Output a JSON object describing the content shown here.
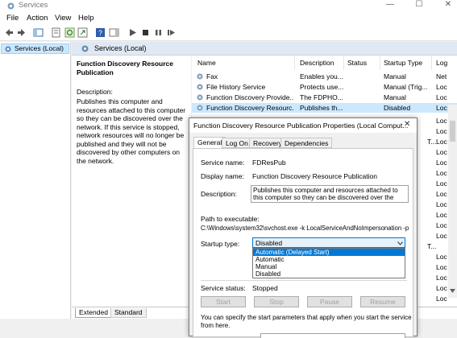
{
  "window": {
    "title": "Services",
    "minimize": "—",
    "maximize": "☐",
    "close": "✕"
  },
  "menu": [
    "File",
    "Action",
    "View",
    "Help"
  ],
  "tree": {
    "selected_label": "Services (Local)"
  },
  "header": {
    "label": "Services (Local)"
  },
  "description_panel": {
    "service_title": "Function Discovery Resource Publication",
    "desc_heading": "Description:",
    "desc_lines": [
      "Publishes this computer and",
      "resources attached to this computer",
      "so they can be discovered over the",
      "network.  If this service is stopped,",
      "network resources will no longer be",
      "published and they will not be",
      "discovered by other computers on",
      "the network."
    ]
  },
  "list": {
    "columns": [
      "Name",
      "Description",
      "Status",
      "Startup Type",
      "Log"
    ],
    "rows": [
      {
        "name": "Fax",
        "description": "Enables you...",
        "status": "",
        "startup": "Manual",
        "logon": "Net"
      },
      {
        "name": "File History Service",
        "description": "Protects use...",
        "status": "",
        "startup": "Manual (Trig...",
        "logon": "Loc"
      },
      {
        "name": "Function Discovery Provide...",
        "description": "The FDPHO...",
        "status": "",
        "startup": "Manual",
        "logon": "Loc"
      },
      {
        "name": "Function Discovery Resourc...",
        "description": "Publishes th...",
        "status": "",
        "startup": "Disabled",
        "logon": "Loc"
      }
    ],
    "extra_logon": [
      "Loc",
      "Loc",
      "Loc",
      "Loc",
      "Loc",
      "Loc",
      "Loc",
      "Loc",
      "Loc",
      "Loc",
      "Loc",
      "Loc",
      "Loc",
      "Loc",
      "Loc",
      "Loc",
      "Loc"
    ],
    "partial_text": [
      "T...",
      "T..."
    ]
  },
  "bottom_tabs": [
    "Extended",
    "Standard"
  ],
  "dialog": {
    "title": "Function Discovery Resource Publication Properties (Local Comput...",
    "close": "✕",
    "tabs": [
      "General",
      "Log On",
      "Recovery",
      "Dependencies"
    ],
    "service_name_label": "Service name:",
    "service_name": "FDResPub",
    "display_name_label": "Display name:",
    "display_name": "Function Discovery Resource Publication",
    "description_label": "Description:",
    "description_lines": [
      "Publishes this computer and resources attached to",
      "this computer so they can be discovered over the"
    ],
    "path_label": "Path to executable:",
    "path": "C:\\Windows\\system32\\svchost.exe -k LocalServiceAndNoImpersonation -p",
    "startup_type_label": "Startup type:",
    "startup_type_value": "Disabled",
    "startup_options": [
      "Automatic (Delayed Start)",
      "Automatic",
      "Manual",
      "Disabled"
    ],
    "service_status_label": "Service status:",
    "service_status": "Stopped",
    "buttons": [
      "Start",
      "Stop",
      "Pause",
      "Resume"
    ],
    "hint_lines": [
      "You can specify the start parameters that apply when you start the service",
      "from here."
    ]
  }
}
